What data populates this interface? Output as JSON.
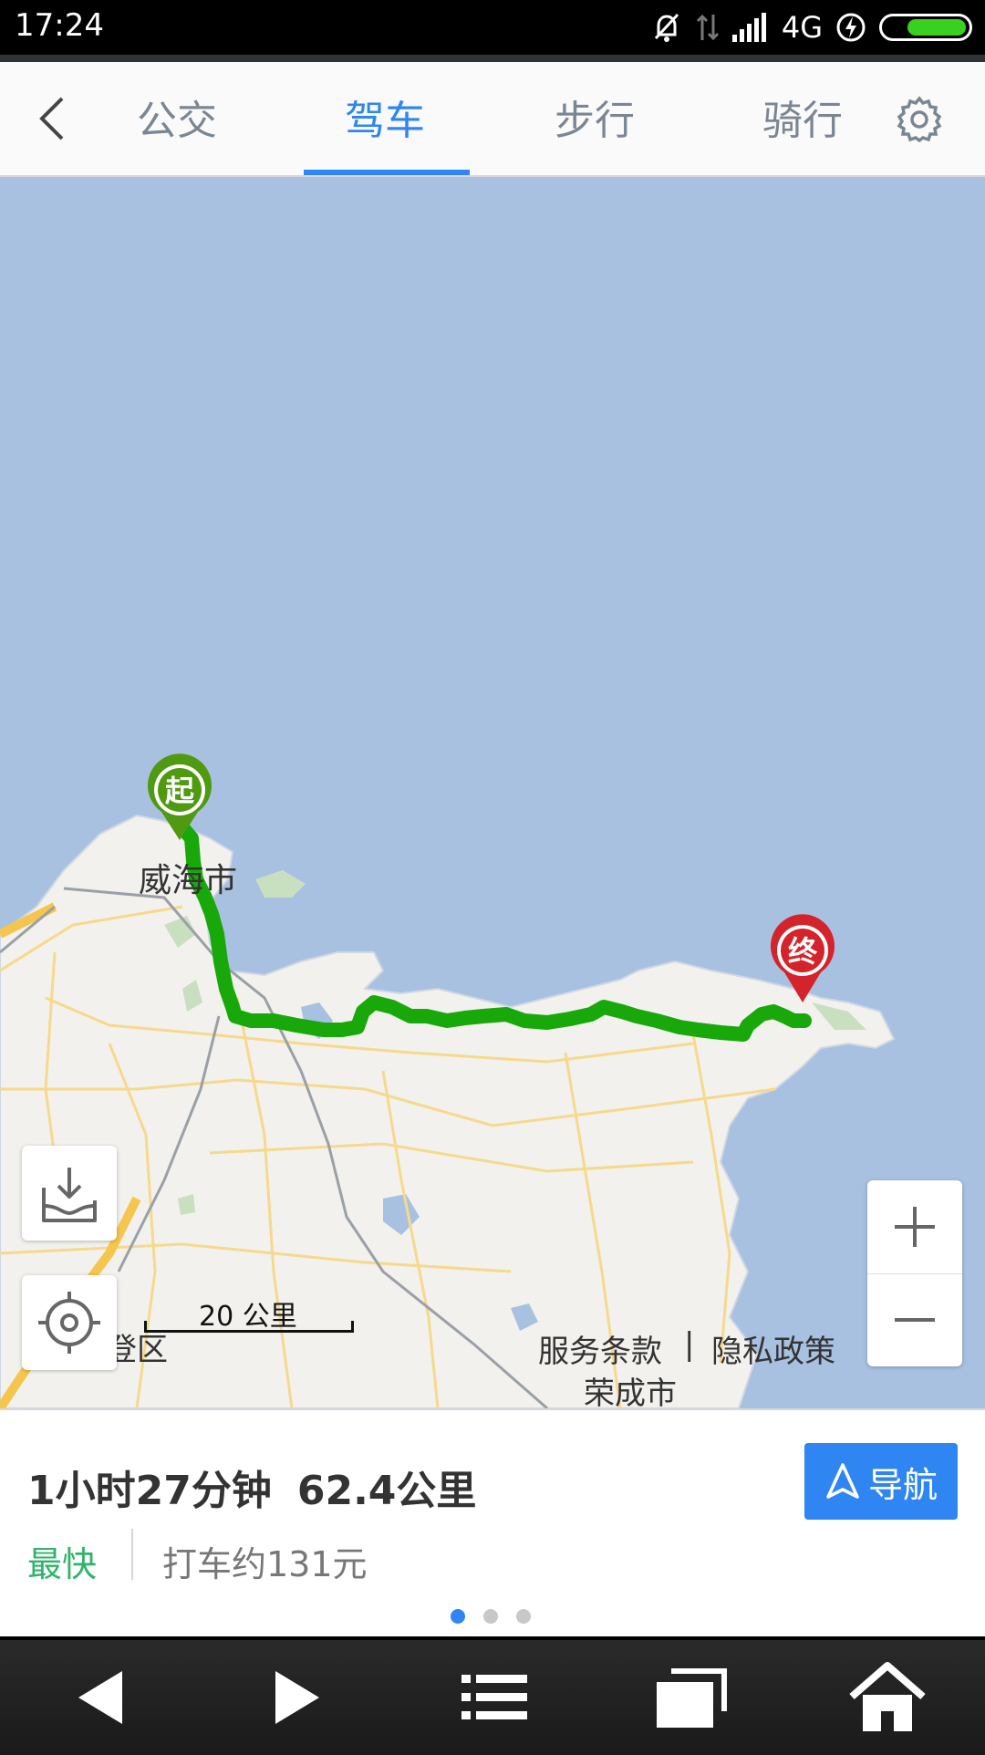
{
  "status": {
    "time": "17:24",
    "network": "4G"
  },
  "tabs": [
    {
      "label": "公交"
    },
    {
      "label": "驾车"
    },
    {
      "label": "步行"
    },
    {
      "label": "骑行"
    }
  ],
  "active_tab": "驾车",
  "map": {
    "city_label": "威海市",
    "start_label": "起",
    "end_label": "终",
    "scale_label": "20 公里",
    "district_label": "文登区",
    "rongcheng_label": "荣成市",
    "terms_label": "服务条款",
    "divider": "|",
    "privacy_label": "隐私政策"
  },
  "route": {
    "duration": "1小时27分钟",
    "distance": "62.4公里",
    "tag": "最快",
    "fare": "打车约131元",
    "nav_label": "导航"
  },
  "colors": {
    "accent": "#2f86f2",
    "route": "#18a80a",
    "start": "#4f9a10",
    "end": "#d4232a",
    "water": "#a8c1e0",
    "land": "#f2f1ee"
  }
}
